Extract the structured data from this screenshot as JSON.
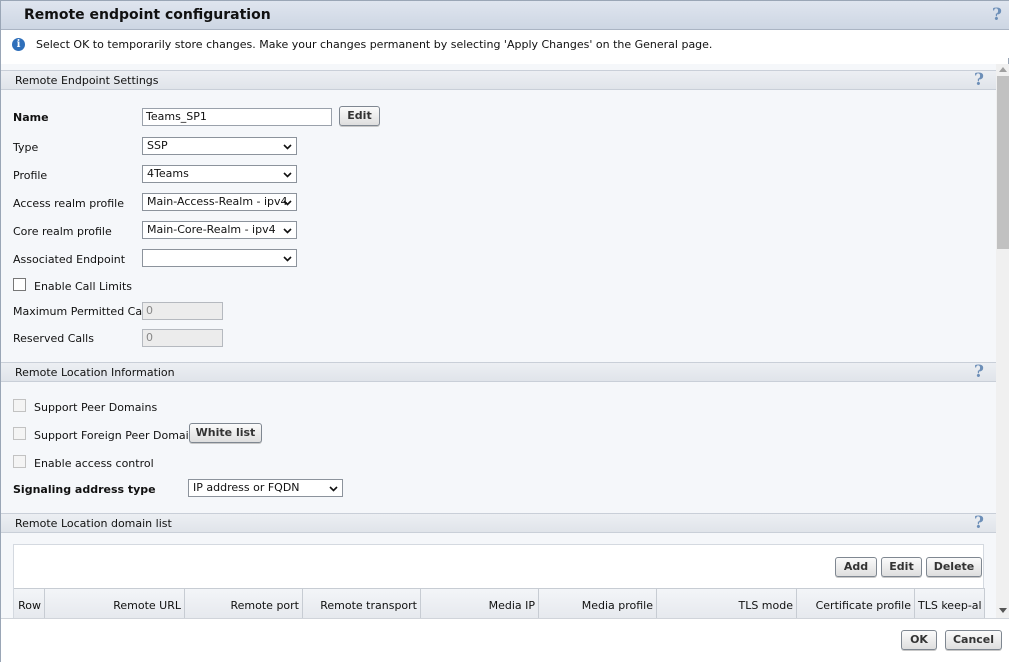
{
  "dialog": {
    "title": "Remote endpoint configuration",
    "help": "?"
  },
  "info": {
    "icon": "i",
    "text": "Select OK to temporarily store changes. Make your changes permanent by selecting 'Apply Changes' on the General page."
  },
  "settings": {
    "section_title": "Remote Endpoint Settings",
    "help": "?",
    "name_label": "Name",
    "name_value": "Teams_SP1",
    "edit_button": "Edit",
    "type_label": "Type",
    "type_value": "SSP",
    "profile_label": "Profile",
    "profile_value": "4Teams",
    "access_realm_label": "Access realm profile",
    "access_realm_value": "Main-Access-Realm - ipv4",
    "core_realm_label": "Core realm profile",
    "core_realm_value": "Main-Core-Realm - ipv4",
    "assoc_endpoint_label": "Associated Endpoint",
    "assoc_endpoint_value": "",
    "enable_call_limits_label": "Enable Call Limits",
    "max_calls_label": "Maximum Permitted Calls",
    "max_calls_value": "0",
    "reserved_calls_label": "Reserved Calls",
    "reserved_calls_value": "0"
  },
  "location": {
    "section_title": "Remote Location Information",
    "help": "?",
    "support_peer_label": "Support Peer Domains",
    "support_foreign_label": "Support Foreign Peer Domains",
    "white_list_button": "White list",
    "access_control_label": "Enable access control",
    "signaling_label": "Signaling address type",
    "signaling_value": "IP address or FQDN"
  },
  "domain_list": {
    "section_title": "Remote Location domain list",
    "help": "?",
    "add_button": "Add",
    "edit_button": "Edit",
    "delete_button": "Delete",
    "columns": [
      "Row",
      "Remote URL",
      "Remote port",
      "Remote transport",
      "Media IP",
      "Media profile",
      "TLS mode",
      "Certificate profile",
      "TLS keep-al"
    ]
  },
  "footer": {
    "ok_button": "OK",
    "cancel_button": "Cancel"
  },
  "icons": {
    "help": "help-icon",
    "info": "info-icon",
    "dropdown": "chevron-down-icon"
  },
  "colors": {
    "titlebar": "#cdd6e3",
    "help_icon": "#6d8fb8",
    "info_icon": "#2f6fba",
    "section_bg": "#f5f7fa"
  }
}
